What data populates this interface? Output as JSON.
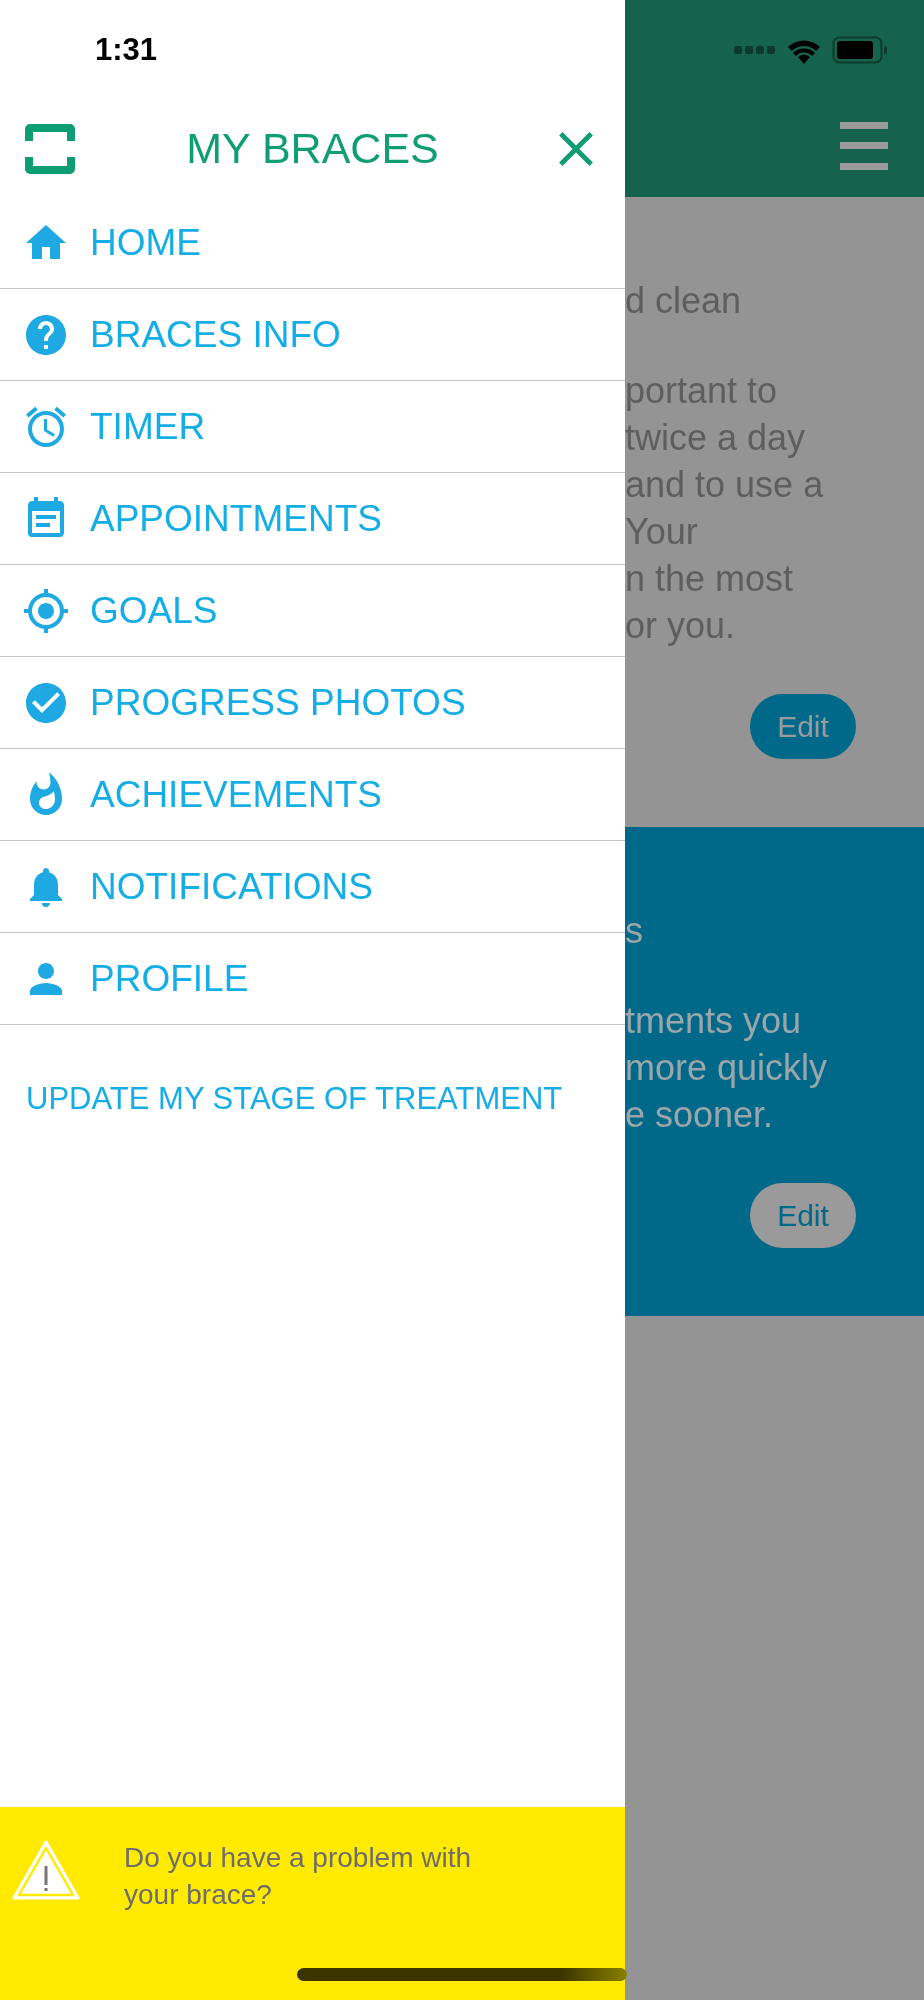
{
  "status_bar": {
    "time": "1:31"
  },
  "drawer": {
    "title": "MY BRACES",
    "items": [
      {
        "label": "HOME"
      },
      {
        "label": "BRACES INFO"
      },
      {
        "label": "TIMER"
      },
      {
        "label": "APPOINTMENTS"
      },
      {
        "label": "GOALS"
      },
      {
        "label": "PROGRESS PHOTOS"
      },
      {
        "label": "ACHIEVEMENTS"
      },
      {
        "label": "NOTIFICATIONS"
      },
      {
        "label": "PROFILE"
      }
    ],
    "link": "UPDATE MY STAGE OF TREATMENT",
    "alert": {
      "text": "Do you have a problem with your brace?"
    }
  },
  "background": {
    "cards": [
      {
        "kind": "grey",
        "title": "d clean",
        "lines": [
          "portant to",
          "twice a day",
          "and to use a",
          "Your",
          "n the most",
          "or you."
        ],
        "button": "Edit"
      },
      {
        "kind": "blue",
        "title": "s",
        "lines": [
          "tments you",
          "more quickly",
          "e sooner."
        ],
        "button": "Edit"
      }
    ]
  }
}
